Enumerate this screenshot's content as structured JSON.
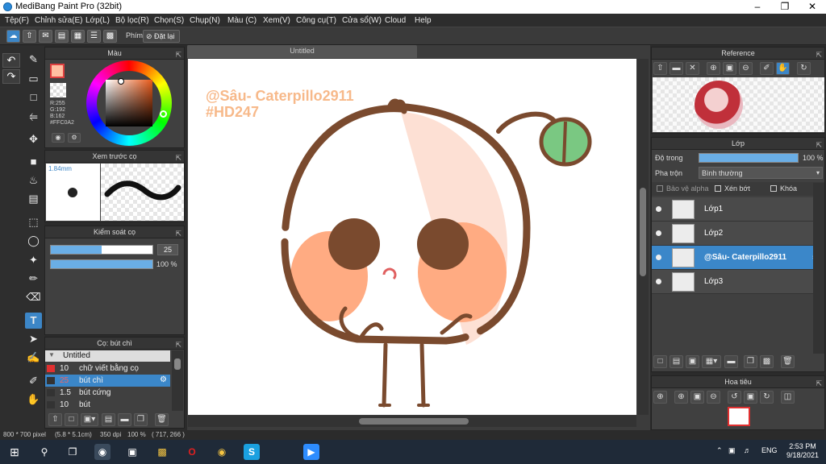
{
  "window": {
    "title": "MediBang Paint Pro (32bit)"
  },
  "menu": [
    "Tệp(F)",
    "Chỉnh sửa(E)",
    "Lớp(L)",
    "Bộ lọc(R)",
    "Chọn(S)",
    "Chụp(N)",
    "Màu (C)",
    "Xem(V)",
    "Công cụ(T)",
    "Cửa sổ(W)",
    "Cloud",
    "Help"
  ],
  "toolbar": {
    "phim_label": "Phím",
    "reset_label": "Đặt lại"
  },
  "color_panel": {
    "title": "Màu",
    "r": "R:255",
    "g": "G:192",
    "b": "B:162",
    "hex": "#FFC0A2",
    "color": "#FFC0A2"
  },
  "brush_preview": {
    "title": "Xem trước cọ",
    "size": "1.84mm"
  },
  "brush_control": {
    "title": "Kiểm soát cọ",
    "size_value": "25",
    "opacity_value": "100 %",
    "size_fraction": 0.5,
    "opacity_fraction": 1.0
  },
  "brush_list": {
    "title": "Cọ: bút chì",
    "group": "Untitled",
    "items": [
      {
        "size": "10",
        "name": "chữ viết bằng cọ",
        "color": "#e03030"
      },
      {
        "size": "25",
        "name": "bút chì",
        "color": "#333333"
      },
      {
        "size": "1.5",
        "name": "bút cứng",
        "color": "#333333"
      },
      {
        "size": "10",
        "name": "bút",
        "color": "#333333"
      }
    ]
  },
  "canvas": {
    "tab": "Untitled",
    "watermark_line1": "@Sâu- Caterpillo2911",
    "watermark_line2": "#HD247"
  },
  "reference_panel": {
    "title": "Reference"
  },
  "layer_panel": {
    "title": "Lớp",
    "opacity_label": "Độ trong",
    "opacity_value": "100 %",
    "opacity_fraction": 1.0,
    "blend_label": "Pha trộn",
    "blend_value": "Bình thường",
    "protect_alpha": "Bảo vệ alpha",
    "clipping": "Xén bớt",
    "lock": "Khóa",
    "layers": [
      {
        "name": "Lớp1"
      },
      {
        "name": "Lớp2"
      },
      {
        "name": "@Sâu- Caterpillo2911"
      },
      {
        "name": "Lớp3"
      }
    ]
  },
  "navigator": {
    "title": "Hoa tiêu"
  },
  "status": {
    "size": "800 * 700 pixel",
    "cm": "(5.8 * 5.1cm)",
    "dpi": "350 dpi",
    "zoom": "100 %",
    "coords": "( 717, 266 )"
  },
  "taskbar": {
    "lang": "ENG",
    "time": "2:53 PM",
    "date": "9/18/2021"
  }
}
